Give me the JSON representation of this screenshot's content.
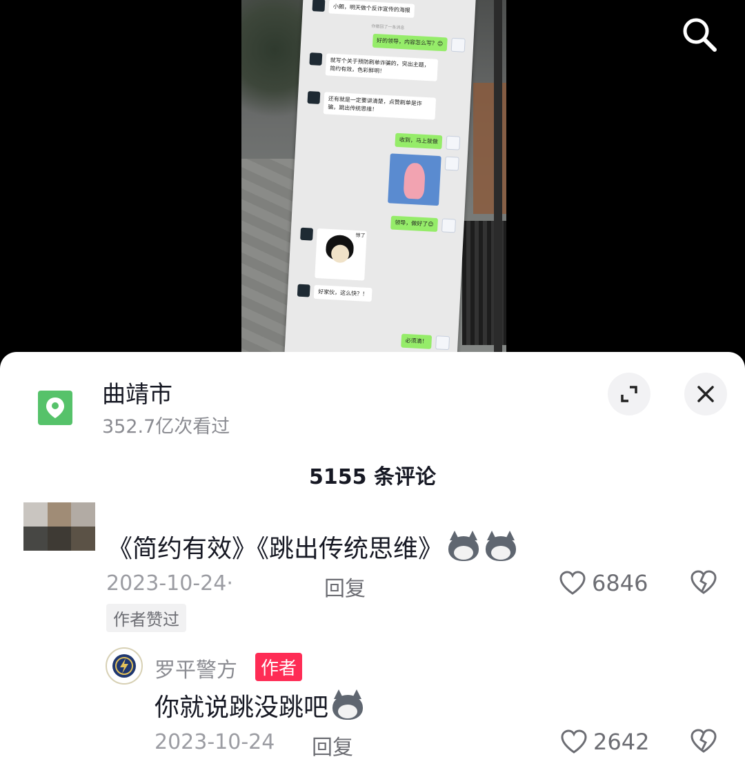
{
  "video": {
    "poster_chat": {
      "messages": [
        {
          "side": "left",
          "text": "小朗，明天做个反诈宣传的海报"
        },
        {
          "side": "sys",
          "text": "你撤回了一条消息"
        },
        {
          "side": "right",
          "text": "好的领导，内容怎么写？😊"
        },
        {
          "side": "left",
          "text": "就写个关于预防刷单诈骗的，突出主题，简约有效，色彩鲜明！"
        },
        {
          "side": "left",
          "text": "还有就是一定要讲清楚，点赞刷单是诈骗，跳出传统思维！"
        },
        {
          "side": "right",
          "text": "收到，马上就做"
        },
        {
          "side": "right",
          "text": "领导，做好了😊"
        },
        {
          "side": "left",
          "text": "好家伙，这么快？！"
        },
        {
          "side": "right",
          "text": "必须滴！"
        }
      ],
      "sticker_text": "惊了"
    }
  },
  "location": {
    "title": "曲靖市",
    "views": "352.7亿次看过"
  },
  "comments_count": "5155 条评论",
  "comments": [
    {
      "text": "《简约有效》《跳出传统思维》",
      "emoji_count": 2,
      "date": "2023-10-24·",
      "reply_label": "回复",
      "likes": "6846",
      "tag": "作者赞过"
    }
  ],
  "reply": {
    "author": "罗平警方",
    "badge": "作者",
    "text": "你就说跳没跳吧",
    "date": "2023-10-24",
    "reply_label": "回复",
    "likes": "2642"
  },
  "icons": {
    "search": "search-icon",
    "location": "location-pin-icon",
    "expand": "expand-icon",
    "close": "close-icon",
    "like": "heart-icon",
    "dislike": "broken-heart-icon",
    "emoji": "doge-emoji-icon"
  },
  "colors": {
    "location_green": "#56c26a",
    "author_badge": "#fe2c55",
    "chat_green": "#95ec69"
  }
}
